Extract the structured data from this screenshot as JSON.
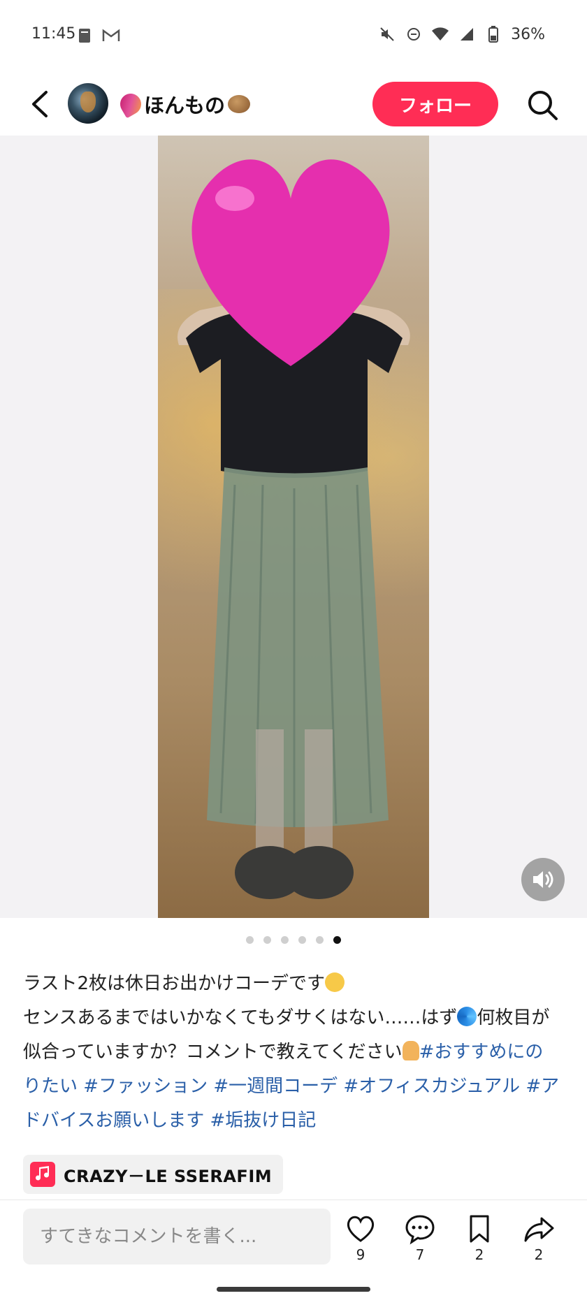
{
  "status": {
    "time": "11:45",
    "battery": "36%",
    "left_icons": [
      "notes-icon",
      "gmail-icon"
    ],
    "right_icons": [
      "mute-icon",
      "dnd-icon",
      "wifi-icon",
      "signal-icon",
      "battery-icon"
    ]
  },
  "header": {
    "user_name": "ほんもの",
    "follow_label": "フォロー"
  },
  "media": {
    "page_count": 6,
    "current_index": 5
  },
  "caption": {
    "line1": "ラスト2枚は休日お出かけコーデです",
    "line2a": "センスあるまではいかなくてもダサくはない……はず",
    "line2b": "何枚目が似合っていますか？コメントで教えてください",
    "tags": [
      "#おすすめにのりたい",
      "#ファッション",
      "#一週間コーデ",
      "#オフィスカジュアル",
      "#アドバイスお願いします",
      "#垢抜け日記"
    ]
  },
  "music": {
    "title": "CRAZY－LE SSERAFIM"
  },
  "bottom": {
    "comment_placeholder": "すてきなコメントを書く...",
    "likes": "9",
    "comments": "7",
    "saves": "2",
    "shares": "2"
  },
  "colors": {
    "accent": "#ff2d55",
    "hashtag": "#2a5fa8"
  }
}
